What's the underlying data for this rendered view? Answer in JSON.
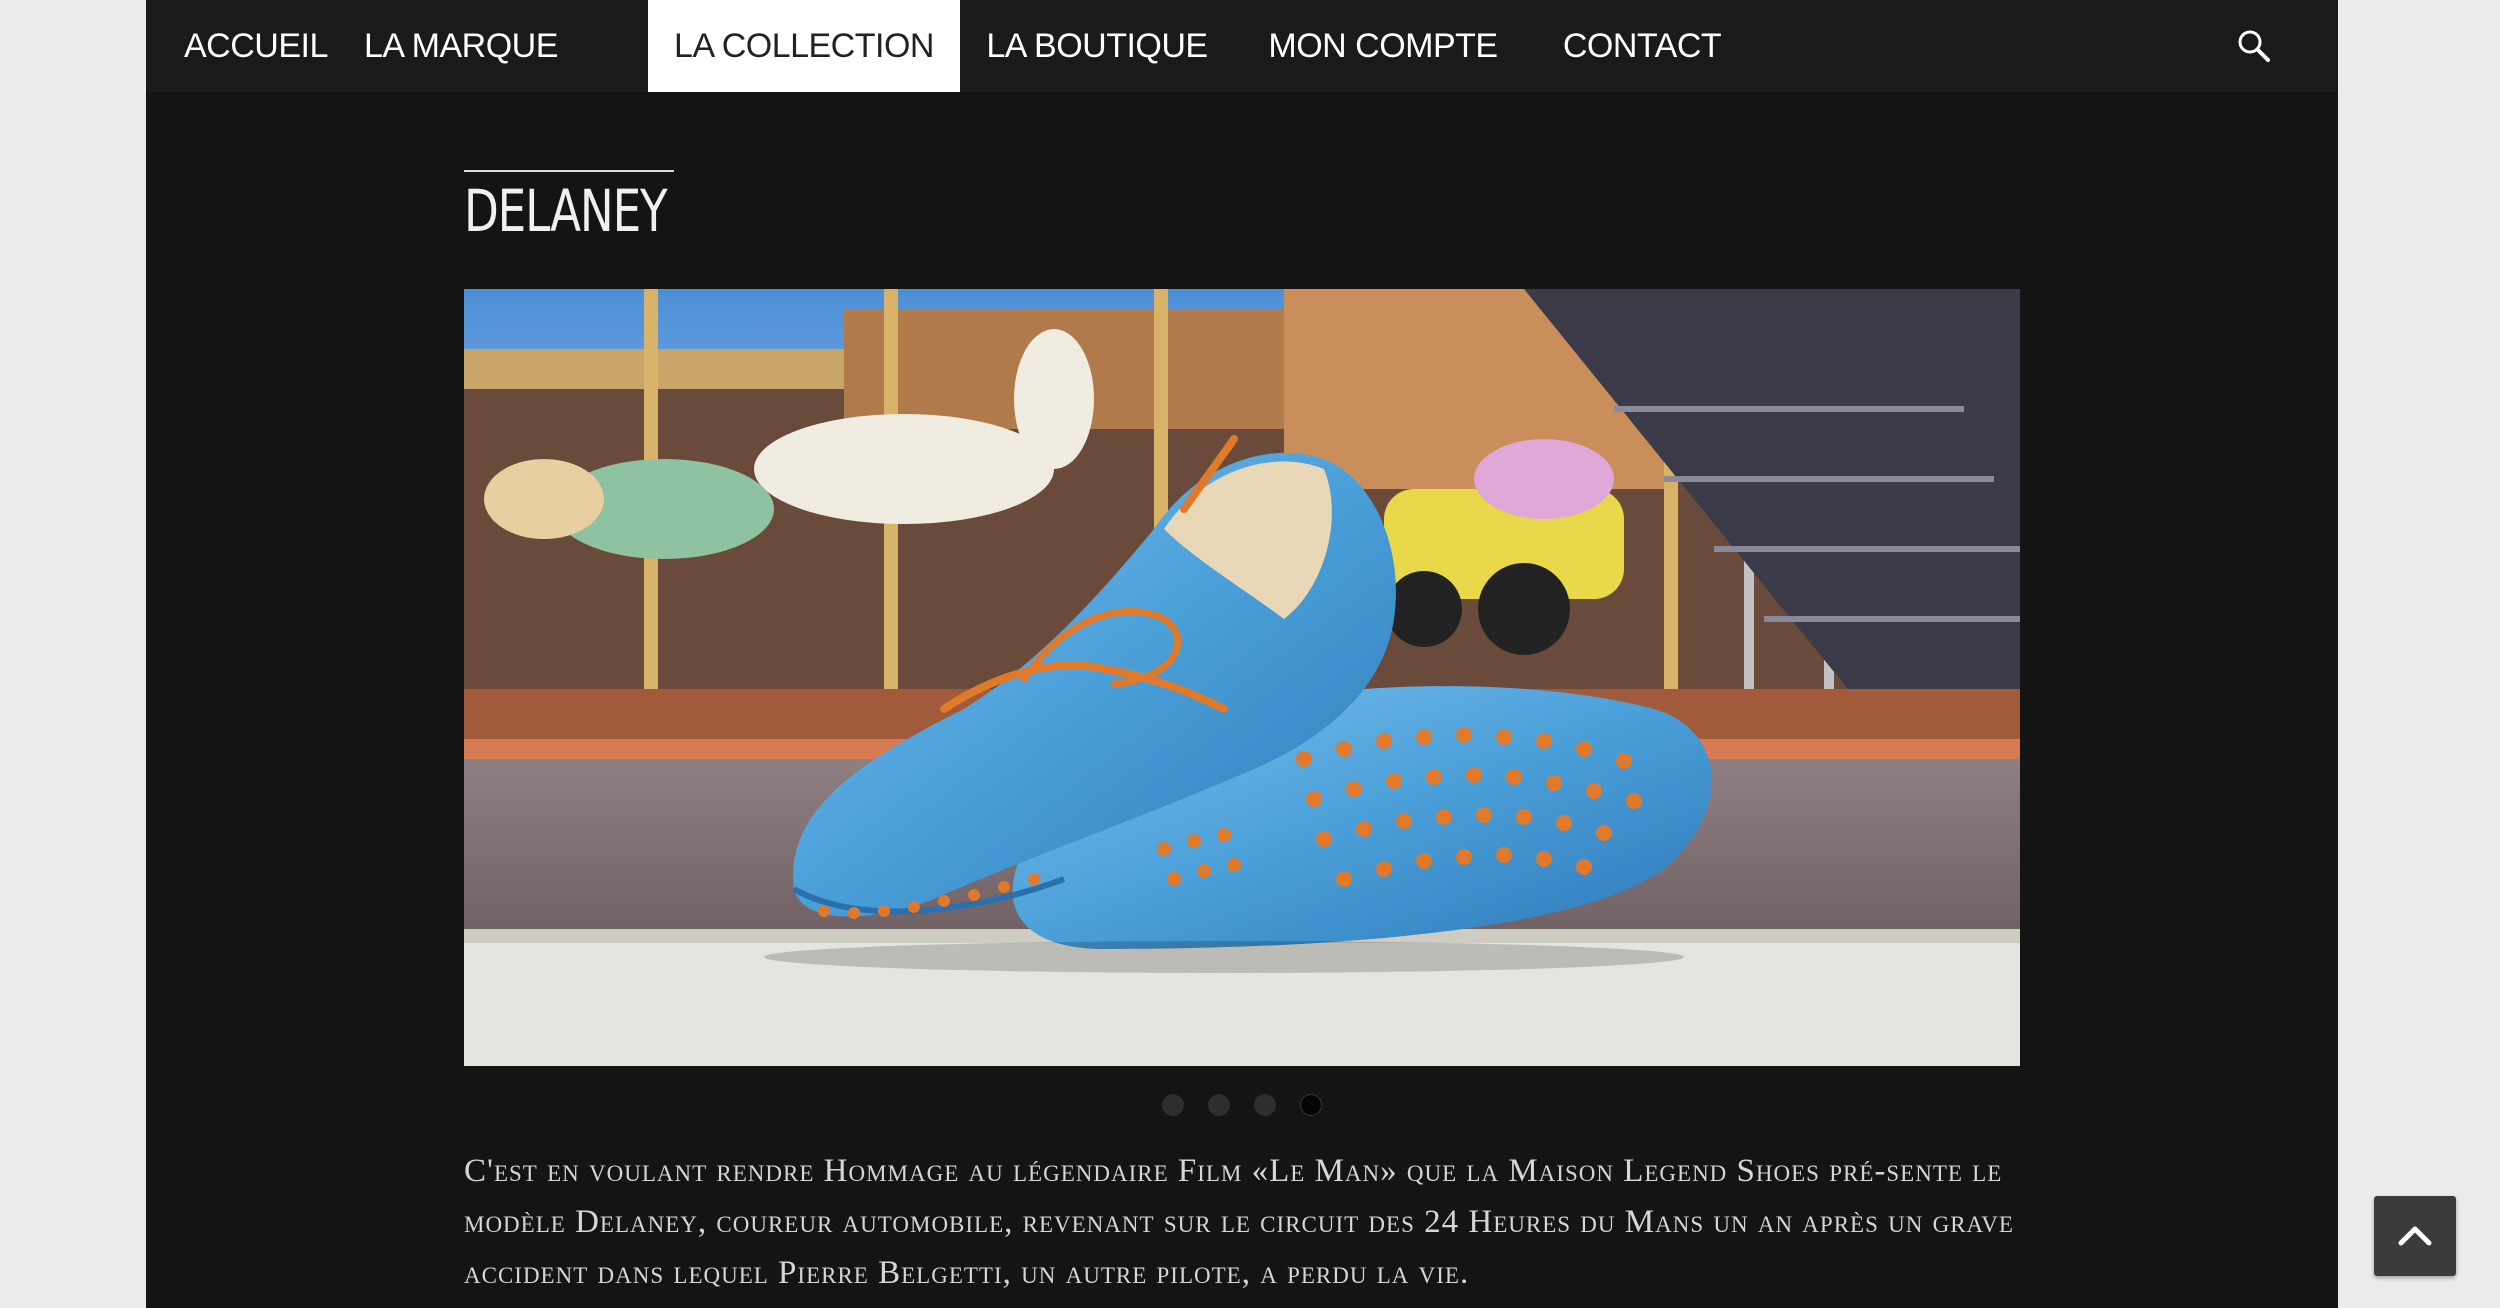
{
  "nav": {
    "items": [
      {
        "label": "ACCUEIL",
        "active": false
      },
      {
        "label": "LA MARQUE",
        "active": false
      },
      {
        "label": "LA COLLECTION",
        "active": true
      },
      {
        "label": "LA BOUTIQUE",
        "active": false
      },
      {
        "label": "MON COMPTE",
        "active": false
      },
      {
        "label": "CONTACT",
        "active": false
      }
    ],
    "search_icon": "search-icon"
  },
  "page": {
    "title": "DELANEY"
  },
  "slider": {
    "image": "blue-driving-moccasin-carousel-photo",
    "dots_count": 4,
    "active_dot": 4
  },
  "description": "C'est en voulant rendre Hommage au légendaire Film «Le Man» que la Maison Legend Shoes pré-sente le modèle Delaney, coureur automobile, revenant sur le circuit des 24 Heures du Mans un an après un grave accident dans lequel Pierre Belgetti, un autre pilote, a perdu la vie.",
  "scroll_top": {
    "icon": "chevron-up-icon"
  },
  "colors": {
    "page_bg": "#141414",
    "nav_bg": "#1a1a1a",
    "active_tab_bg": "#ffffff",
    "shoe_blue": "#4a9fd8",
    "lace_orange": "#e07a2a"
  }
}
